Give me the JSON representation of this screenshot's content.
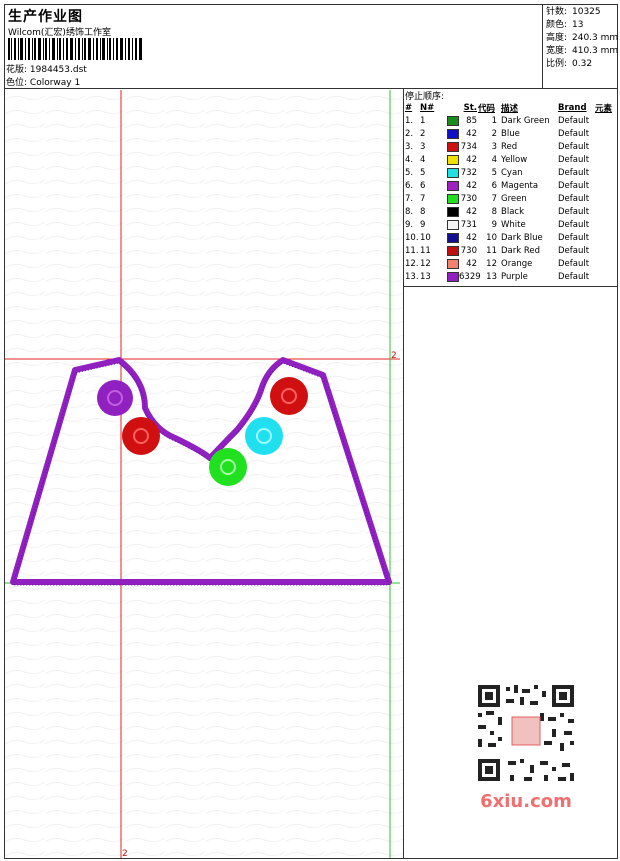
{
  "header": {
    "title": "生产作业图",
    "company": "Wilcom(汇宏)绣饰工作室",
    "design_label": "花版:",
    "design_value": "1984453.dst",
    "colorway_label": "色位:",
    "colorway_value": "Colorway 1"
  },
  "stats": {
    "stitches_label": "针数:",
    "stitches_value": "10325",
    "colors_label": "颜色:",
    "colors_value": "13",
    "height_label": "高度:",
    "height_value": "240.3 mm",
    "width_label": "宽度:",
    "width_value": "410.3 mm",
    "scale_label": "比例:",
    "scale_value": "0.32"
  },
  "canvas": {
    "marker_top": "2",
    "marker_bottom": "2"
  },
  "stop_sequence": {
    "heading": "停止顺序:",
    "columns": [
      "#",
      "N#",
      "St.",
      "代码",
      "描述",
      "Brand",
      "元素"
    ],
    "rows": [
      {
        "idx": "1.",
        "n": "1",
        "color": "#1a8a1a",
        "st": "85",
        "code": "1",
        "desc": "Dark Green",
        "brand": "Default"
      },
      {
        "idx": "2.",
        "n": "2",
        "color": "#1010c8",
        "st": "42",
        "code": "2",
        "desc": "Blue",
        "brand": "Default"
      },
      {
        "idx": "3.",
        "n": "3",
        "color": "#d01010",
        "st": "734",
        "code": "3",
        "desc": "Red",
        "brand": "Default"
      },
      {
        "idx": "4.",
        "n": "4",
        "color": "#f0e000",
        "st": "42",
        "code": "4",
        "desc": "Yellow",
        "brand": "Default"
      },
      {
        "idx": "5.",
        "n": "5",
        "color": "#20e0e0",
        "st": "732",
        "code": "5",
        "desc": "Cyan",
        "brand": "Default"
      },
      {
        "idx": "6.",
        "n": "6",
        "color": "#a020c0",
        "st": "42",
        "code": "6",
        "desc": "Magenta",
        "brand": "Default"
      },
      {
        "idx": "7.",
        "n": "7",
        "color": "#20e020",
        "st": "730",
        "code": "7",
        "desc": "Green",
        "brand": "Default"
      },
      {
        "idx": "8.",
        "n": "8",
        "color": "#000000",
        "st": "42",
        "code": "8",
        "desc": "Black",
        "brand": "Default"
      },
      {
        "idx": "9.",
        "n": "9",
        "color": "#f4f4f4",
        "st": "731",
        "code": "9",
        "desc": "White",
        "brand": "Default"
      },
      {
        "idx": "10.",
        "n": "10",
        "color": "#101090",
        "st": "42",
        "code": "10",
        "desc": "Dark Blue",
        "brand": "Default"
      },
      {
        "idx": "11.",
        "n": "11",
        "color": "#c01010",
        "st": "730",
        "code": "11",
        "desc": "Dark Red",
        "brand": "Default"
      },
      {
        "idx": "12.",
        "n": "12",
        "color": "#f08070",
        "st": "42",
        "code": "12",
        "desc": "Orange",
        "brand": "Default"
      },
      {
        "idx": "13.",
        "n": "13",
        "color": "#9020c0",
        "st": "6329",
        "code": "13",
        "desc": "Purple",
        "brand": "Default"
      }
    ]
  },
  "watermark": {
    "text": "6xiu.com"
  }
}
